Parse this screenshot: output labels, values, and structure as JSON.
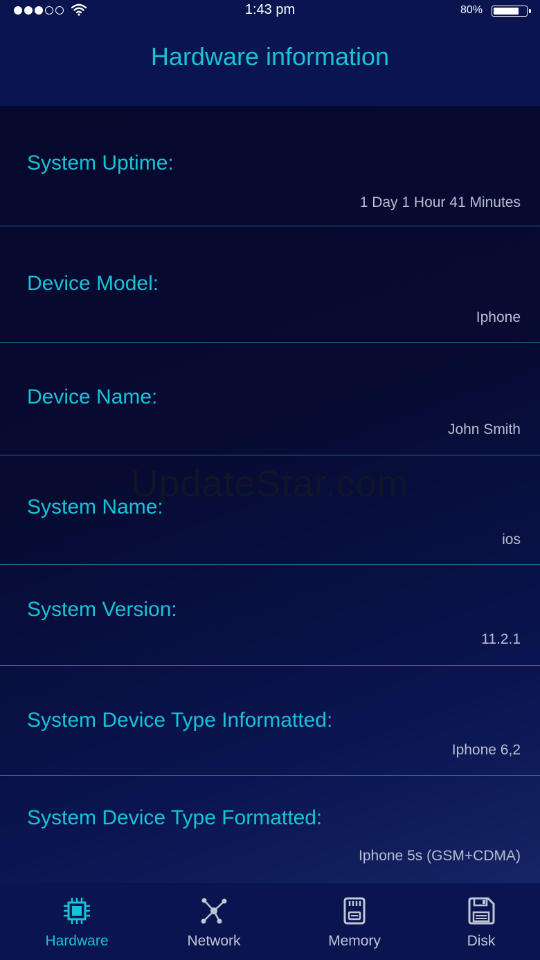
{
  "status_bar": {
    "time": "1:43 pm",
    "battery_text": "80%",
    "battery_level": 0.8,
    "signal_full": 3,
    "signal_total": 5
  },
  "header": {
    "title": "Hardware information"
  },
  "rows": [
    {
      "label": "System Uptime:",
      "value": "1 Day 1 Hour 41 Minutes"
    },
    {
      "label": "Device Model:",
      "value": "Iphone"
    },
    {
      "label": "Device Name:",
      "value": "John Smith"
    },
    {
      "label": "System Name:",
      "value": "ios"
    },
    {
      "label": "System Version:",
      "value": "11.2.1"
    },
    {
      "label": "System Device Type Informatted:",
      "value": "Iphone 6,2"
    },
    {
      "label": "System Device Type Formatted:",
      "value": "Iphone 5s (GSM+CDMA)"
    }
  ],
  "watermark": "UpdateStar.com",
  "tabs": [
    {
      "label": "Hardware",
      "icon": "chip-icon",
      "active": true
    },
    {
      "label": "Network",
      "icon": "network-icon",
      "active": false
    },
    {
      "label": "Memory",
      "icon": "sd-card-icon",
      "active": false
    },
    {
      "label": "Disk",
      "icon": "floppy-disk-icon",
      "active": false
    }
  ],
  "colors": {
    "accent": "#17c3d8",
    "bar_bg": "#0a1550",
    "value_text": "#b8bfd0",
    "divider": "#1a6f8f"
  }
}
